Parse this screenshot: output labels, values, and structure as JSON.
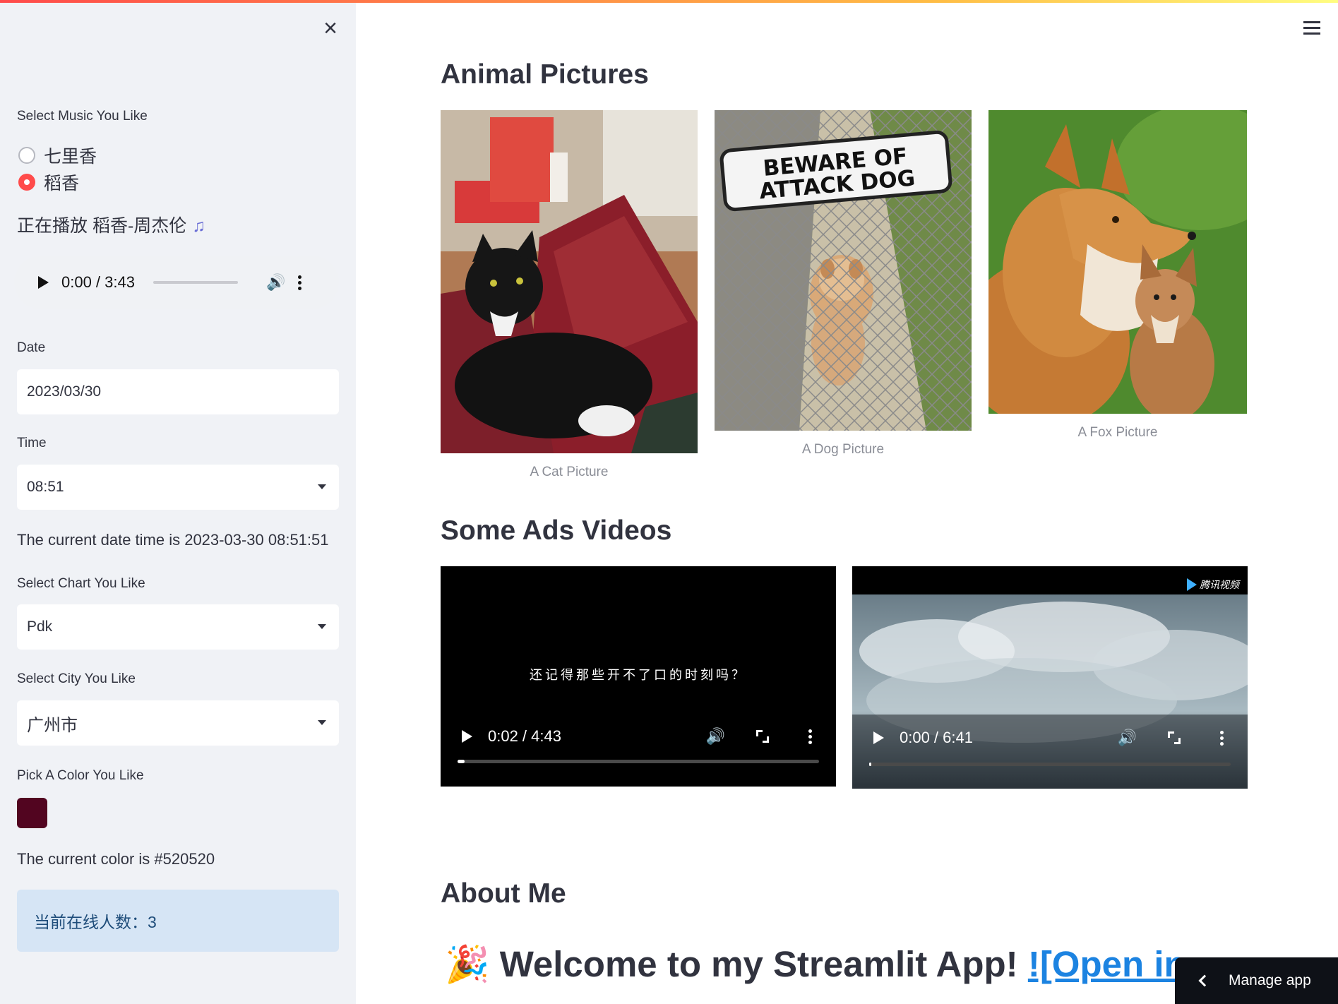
{
  "sidebar": {
    "music_label": "Select Music You Like",
    "music_options": [
      "七里香",
      "稻香"
    ],
    "now_playing": "正在播放 稻香-周杰伦",
    "audio_time": "0:00 / 3:43",
    "date_label": "Date",
    "date_value": "2023/03/30",
    "time_label": "Time",
    "time_value": "08:51",
    "datetime_text": "The current date time is 2023-03-30 08:51:51",
    "chart_label": "Select Chart You Like",
    "chart_value": "Pdk",
    "city_label": "Select City You Like",
    "city_value": "广州市",
    "color_label": "Pick A Color You Like",
    "color_value": "#520520",
    "color_text": "The current color is #520520",
    "online_text": "当前在线人数：3"
  },
  "main": {
    "animal_heading": "Animal Pictures",
    "cat_caption": "A Cat Picture",
    "dog_caption": "A Dog Picture",
    "fox_caption": "A Fox Picture",
    "dog_sign_line1": "BEWARE OF",
    "dog_sign_line2": "ATTACK DOG",
    "ads_heading": "Some Ads Videos",
    "video1_subtitle": "还记得那些开不了口的时刻吗？",
    "video1_time": "0:02 / 4:43",
    "video1_progress": 0.02,
    "video2_logo": "腾讯视频",
    "video2_time": "0:00 / 6:41",
    "video2_progress": 0.0,
    "about_heading": "About Me",
    "welcome_text": "Welcome to my Streamlit App! ",
    "welcome_link": "![Open in",
    "manage_app": "Manage app"
  }
}
